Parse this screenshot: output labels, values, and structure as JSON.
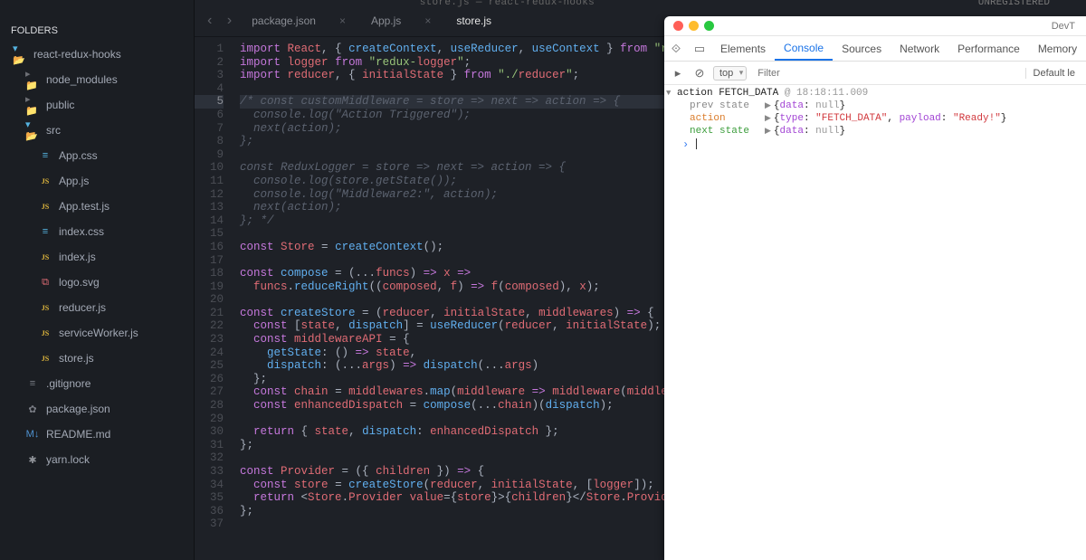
{
  "titlebar": {
    "center_prefix": "store.js",
    "center_project": "react-redux-hooks",
    "unregistered": "UNREGISTERED"
  },
  "sidebar": {
    "heading": "FOLDERS",
    "root": "react-redux-hooks",
    "items": [
      {
        "id": "node_modules",
        "label": "node_modules",
        "icon": "folder",
        "depth": 1
      },
      {
        "id": "public",
        "label": "public",
        "icon": "folder",
        "depth": 1
      },
      {
        "id": "src",
        "label": "src",
        "icon": "folder-open",
        "depth": 1
      },
      {
        "id": "appcss",
        "label": "App.css",
        "icon": "css",
        "depth": 2
      },
      {
        "id": "appjs",
        "label": "App.js",
        "icon": "js",
        "depth": 2
      },
      {
        "id": "apptest",
        "label": "App.test.js",
        "icon": "js",
        "depth": 2
      },
      {
        "id": "indexcss",
        "label": "index.css",
        "icon": "css",
        "depth": 2
      },
      {
        "id": "indexjs",
        "label": "index.js",
        "icon": "js",
        "depth": 2
      },
      {
        "id": "logosvg",
        "label": "logo.svg",
        "icon": "svg",
        "depth": 2
      },
      {
        "id": "reducer",
        "label": "reducer.js",
        "icon": "js",
        "depth": 2
      },
      {
        "id": "sw",
        "label": "serviceWorker.js",
        "icon": "js",
        "depth": 2
      },
      {
        "id": "store",
        "label": "store.js",
        "icon": "js",
        "depth": 2
      },
      {
        "id": "gitignore",
        "label": ".gitignore",
        "icon": "gitignore",
        "depth": 1
      },
      {
        "id": "pkg",
        "label": "package.json",
        "icon": "gear",
        "depth": 1
      },
      {
        "id": "readme",
        "label": "README.md",
        "icon": "md",
        "depth": 1
      },
      {
        "id": "yarn",
        "label": "yarn.lock",
        "icon": "asterisk",
        "depth": 1
      }
    ]
  },
  "tabs": [
    {
      "label": "package.json",
      "closeable": true,
      "active": false
    },
    {
      "label": "App.js",
      "closeable": true,
      "active": false
    },
    {
      "label": "store.js",
      "closeable": false,
      "active": true
    }
  ],
  "editor": {
    "highlighted_line": 5,
    "lines": [
      "import React, { createContext, useReducer, useContext } from \"react\";",
      "import logger from \"redux-logger\";",
      "import reducer, { initialState } from \"./reducer\";",
      "",
      "/* const customMiddleware = store => next => action => {",
      "  console.log(\"Action Triggered\");",
      "  next(action);",
      "};",
      "",
      "const ReduxLogger = store => next => action => {",
      "  console.log(store.getState());",
      "  console.log(\"Middleware2:\", action);",
      "  next(action);",
      "}; */",
      "",
      "const Store = createContext();",
      "",
      "const compose = (...funcs) => x =>",
      "  funcs.reduceRight((composed, f) => f(composed), x);",
      "",
      "const createStore = (reducer, initialState, middlewares) => {",
      "  const [state, dispatch] = useReducer(reducer, initialState);",
      "  const middlewareAPI = {",
      "    getState: () => state,",
      "    dispatch: (...args) => dispatch(...args)",
      "  };",
      "  const chain = middlewares.map(middleware => middleware(middlewareAPI));",
      "  const enhancedDispatch = compose(...chain)(dispatch);",
      "",
      "  return { state, dispatch: enhancedDispatch };",
      "};",
      "",
      "const Provider = ({ children }) => {",
      "  const store = createStore(reducer, initialState, [logger]);",
      "  return <Store.Provider value={store}>{children}</Store.Provider>;",
      "};",
      ""
    ]
  },
  "devtools": {
    "title": "DevT",
    "tabs": [
      "Elements",
      "Console",
      "Sources",
      "Network",
      "Performance",
      "Memory"
    ],
    "active_tab": "Console",
    "context": "top",
    "filter_placeholder": "Filter",
    "levels": "Default le",
    "action_header": {
      "name": "action FETCH_DATA",
      "time": "@ 18:18:11.009"
    },
    "log": {
      "prev_label": "prev state",
      "prev_value": "{data: null}",
      "action_label": "action",
      "action_value": "{type: \"FETCH_DATA\", payload: \"Ready!\"}",
      "next_label": "next state",
      "next_value": "{data: null}"
    }
  }
}
